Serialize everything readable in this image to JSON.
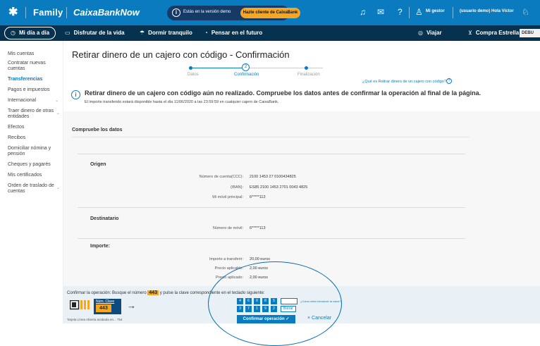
{
  "topbar": {
    "brand_family": "Family",
    "brand_now": "CaixaBankNow",
    "demo_text": "Estás en la versión demo",
    "demo_cta": "Hazte cliente de CaixaBank",
    "gestor": "Mi gestor",
    "user": "(usuario demo) Hola Víctor"
  },
  "nav": {
    "items": [
      "Mi día a día",
      "Disfrutar de la vida",
      "Dormir tranquilo",
      "Pensar en el futuro"
    ],
    "viajar": "Viajar",
    "compra": "Compra Estrella",
    "debug": "DEBU"
  },
  "sidebar": {
    "items": [
      "Mis cuentas",
      "Contratar nuevas cuentas",
      "Transferencias",
      "Pagos e impuestos",
      "Internacional",
      "Traer dinero de otras entidades",
      "Efectos",
      "Recibos",
      "Domiciliar nómina y pensión",
      "Cheques y pagarés",
      "Mis certificados",
      "Orden de traslado de cuentas"
    ],
    "active_index": 2
  },
  "page": {
    "title": "Retirar dinero de un cajero con código - Confirmación",
    "steps": [
      "Datos",
      "Confirmación",
      "Finalización"
    ],
    "current_step": 2,
    "help_link": "¿Qué es Retirar dinero de un cajero con código?",
    "alert_title": "Retirar dinero de un cajero con código aún no realizado. Compruebe los datos antes de confirmar la operación al final de la página.",
    "alert_sub": "El importe transferido estará disponible hasta el día 11/06/2020 a las 23:59:59 en cualquier cajero de CaixaBank.",
    "section": "Compruebe los datos"
  },
  "origen": {
    "title": "Origen",
    "rows": [
      {
        "label": "Número de cuenta(CCC):",
        "value": "2100 1453 27 0100434825"
      },
      {
        "label": "(IBAN):",
        "value": "ES85 2100 1453 2701 0043 4825"
      },
      {
        "label": "Mi móvil principal:",
        "value": "6*****113"
      }
    ]
  },
  "destinatario": {
    "title": "Destinatario",
    "rows": [
      {
        "label": "Número de móvil:",
        "value": "6*****113"
      }
    ]
  },
  "importe": {
    "title": "Importe:",
    "rows": [
      {
        "label": "Importe a transferir:",
        "value": "20,00 euros"
      },
      {
        "label": "Precio aplicable:",
        "value": "2,00 euros"
      },
      {
        "label": "Precio aplicado:",
        "value": "2,00 euros"
      }
    ]
  },
  "confirm": {
    "text_before": "Confirmar la operación: Busque el número",
    "number": "443",
    "text_after": "y pulse la clave correspondiente en el teclado siguiente:",
    "card_label": "Núm. Clave",
    "card_value": "443",
    "card_note": "Tarjeta Línea Abierta acabada en... 754",
    "keys_row1": [
      "4",
      "6",
      "0",
      "8",
      "5"
    ],
    "keys_row2": [
      "3",
      "7",
      "1",
      "9",
      "2"
    ],
    "delete": "Borrar",
    "help": "¿Cómo debo introducir la clave?",
    "btn_confirm": "Confirmar operación",
    "btn_cancel": "Cancelar"
  },
  "colors": {
    "primary": "#0a7bbf",
    "nav": "#07324f",
    "accent": "#f5a623"
  }
}
